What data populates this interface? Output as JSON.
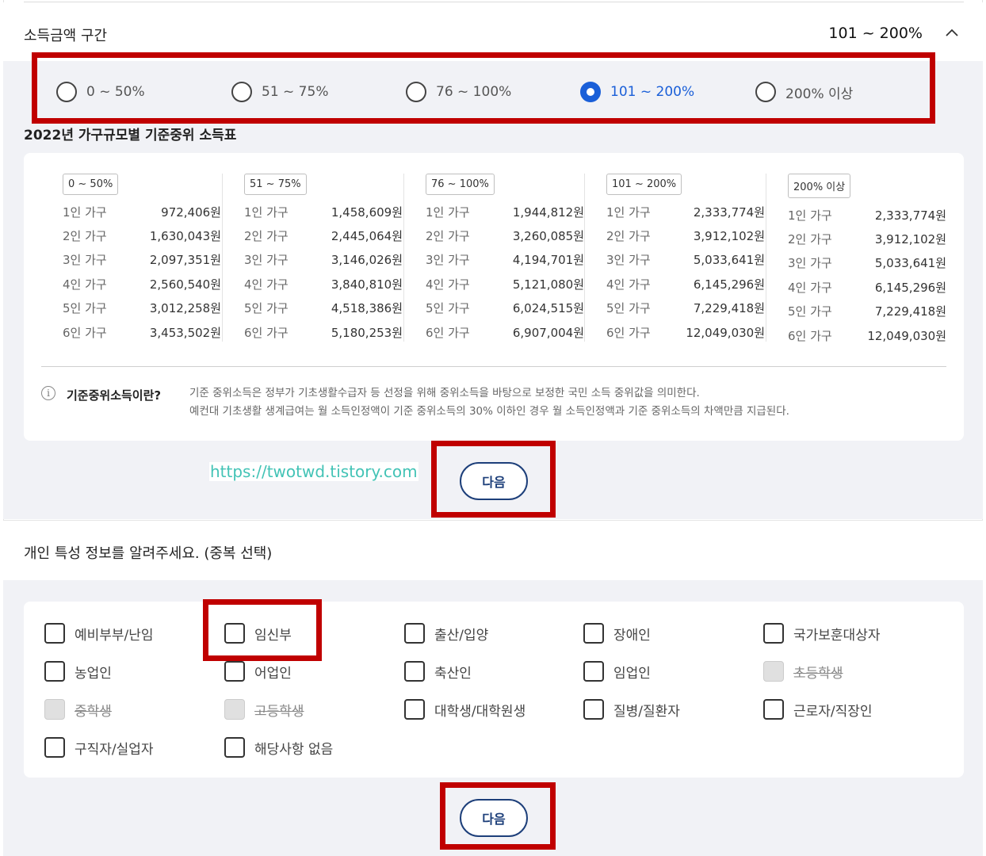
{
  "income_section": {
    "title": "소득금액 구간",
    "selected_value": "101 ~ 200%",
    "options": [
      {
        "label": "0 ~ 50%",
        "selected": false
      },
      {
        "label": "51 ~ 75%",
        "selected": false
      },
      {
        "label": "76 ~ 100%",
        "selected": false
      },
      {
        "label": "101 ~ 200%",
        "selected": true
      },
      {
        "label": "200% 이상",
        "selected": false
      }
    ]
  },
  "median_table": {
    "title": "2022년 가구규모별 기준중위 소득표",
    "columns": [
      {
        "tag": "0 ~ 50%",
        "rows": [
          {
            "k": "1인 가구",
            "v": "972,406원"
          },
          {
            "k": "2인 가구",
            "v": "1,630,043원"
          },
          {
            "k": "3인 가구",
            "v": "2,097,351원"
          },
          {
            "k": "4인 가구",
            "v": "2,560,540원"
          },
          {
            "k": "5인 가구",
            "v": "3,012,258원"
          },
          {
            "k": "6인 가구",
            "v": "3,453,502원"
          }
        ]
      },
      {
        "tag": "51 ~ 75%",
        "rows": [
          {
            "k": "1인 가구",
            "v": "1,458,609원"
          },
          {
            "k": "2인 가구",
            "v": "2,445,064원"
          },
          {
            "k": "3인 가구",
            "v": "3,146,026원"
          },
          {
            "k": "4인 가구",
            "v": "3,840,810원"
          },
          {
            "k": "5인 가구",
            "v": "4,518,386원"
          },
          {
            "k": "6인 가구",
            "v": "5,180,253원"
          }
        ]
      },
      {
        "tag": "76 ~ 100%",
        "rows": [
          {
            "k": "1인 가구",
            "v": "1,944,812원"
          },
          {
            "k": "2인 가구",
            "v": "3,260,085원"
          },
          {
            "k": "3인 가구",
            "v": "4,194,701원"
          },
          {
            "k": "4인 가구",
            "v": "5,121,080원"
          },
          {
            "k": "5인 가구",
            "v": "6,024,515원"
          },
          {
            "k": "6인 가구",
            "v": "6,907,004원"
          }
        ]
      },
      {
        "tag": "101 ~ 200%",
        "rows": [
          {
            "k": "1인 가구",
            "v": "2,333,774원"
          },
          {
            "k": "2인 가구",
            "v": "3,912,102원"
          },
          {
            "k": "3인 가구",
            "v": "5,033,641원"
          },
          {
            "k": "4인 가구",
            "v": "6,145,296원"
          },
          {
            "k": "5인 가구",
            "v": "7,229,418원"
          },
          {
            "k": "6인 가구",
            "v": "12,049,030원"
          }
        ]
      },
      {
        "tag": "200% 이상",
        "rows": [
          {
            "k": "1인 가구",
            "v": "2,333,774원"
          },
          {
            "k": "2인 가구",
            "v": "3,912,102원"
          },
          {
            "k": "3인 가구",
            "v": "5,033,641원"
          },
          {
            "k": "4인 가구",
            "v": "6,145,296원"
          },
          {
            "k": "5인 가구",
            "v": "7,229,418원"
          },
          {
            "k": "6인 가구",
            "v": "12,049,030원"
          }
        ]
      }
    ],
    "info_label": "기준중위소득이란?",
    "info_line1": "기준 중위소득은 정부가 기초생활수급자 등 선정을 위해 중위소득을 바탕으로 보정한 국민 소득 중위값을 의미한다.",
    "info_line2": "예컨대 기초생활 생계급여는 월 소득인정액이 기준 중위소득의 30% 이하인 경우 월 소득인정액과 기준 중위소득의 차액만큼 지급된다."
  },
  "watermark": "https://twotwd.tistory.com",
  "next_label": "다음",
  "personal_section": {
    "title": "개인 특성 정보를 알려주세요. (중복 선택)",
    "options": [
      {
        "label": "예비부부/난임",
        "disabled": false
      },
      {
        "label": "임신부",
        "disabled": false
      },
      {
        "label": "출산/입양",
        "disabled": false
      },
      {
        "label": "장애인",
        "disabled": false
      },
      {
        "label": "국가보훈대상자",
        "disabled": false
      },
      {
        "label": "농업인",
        "disabled": false
      },
      {
        "label": "어업인",
        "disabled": false
      },
      {
        "label": "축산인",
        "disabled": false
      },
      {
        "label": "임업인",
        "disabled": false
      },
      {
        "label": "초등학생",
        "disabled": true
      },
      {
        "label": "중학생",
        "disabled": true
      },
      {
        "label": "고등학생",
        "disabled": true
      },
      {
        "label": "대학생/대학원생",
        "disabled": false
      },
      {
        "label": "질병/질환자",
        "disabled": false
      },
      {
        "label": "근로자/직장인",
        "disabled": false
      },
      {
        "label": "구직자/실업자",
        "disabled": false
      },
      {
        "label": "해당사항 없음",
        "disabled": false
      }
    ]
  }
}
